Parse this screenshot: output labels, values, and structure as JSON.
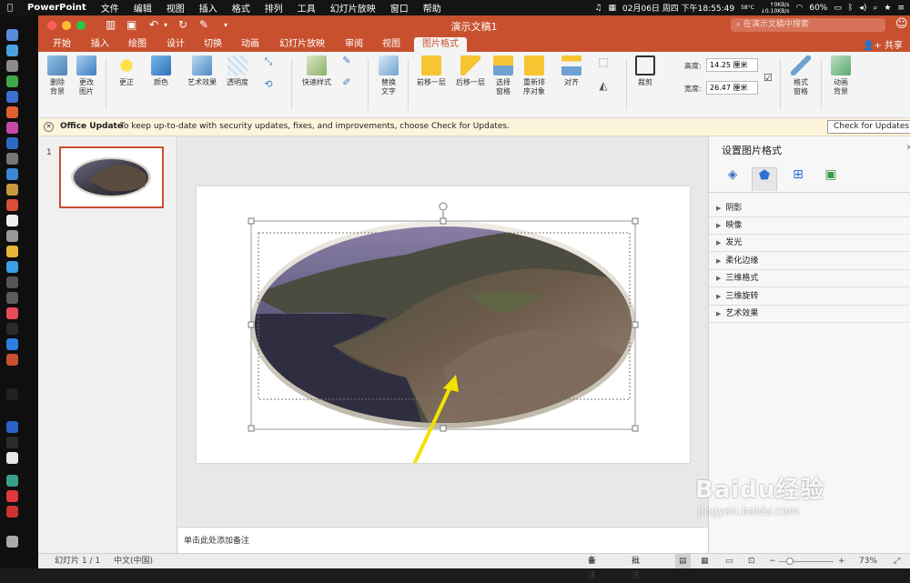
{
  "menubar": {
    "app": "PowerPoint",
    "items": [
      "文件",
      "编辑",
      "视图",
      "插入",
      "格式",
      "排列",
      "工具",
      "幻灯片放映",
      "窗口",
      "帮助"
    ],
    "clock": "02月06日 周四 下午18:55:49",
    "temp": "58°C",
    "net_up": "↑0KB/s",
    "net_down": "↓0.10KB/s",
    "battery": "60%"
  },
  "window": {
    "title": "演示文稿1",
    "search_placeholder": "在演示文稿中搜索",
    "share_label": "共享"
  },
  "tabs": [
    "开始",
    "插入",
    "绘图",
    "设计",
    "切换",
    "动画",
    "幻灯片放映",
    "审阅",
    "视图",
    "图片格式"
  ],
  "active_tab": "图片格式",
  "ribbon": {
    "buttons": [
      {
        "id": "remove-bg",
        "label": "删除\n背景"
      },
      {
        "id": "change-pic",
        "label": "更改\n图片"
      },
      {
        "id": "corrections",
        "label": "更正"
      },
      {
        "id": "color",
        "label": "颜色"
      },
      {
        "id": "artistic",
        "label": "艺术效果"
      },
      {
        "id": "transparency",
        "label": "透明度"
      },
      {
        "id": "quick-styles",
        "label": "快速样式"
      },
      {
        "id": "alt-text",
        "label": "替换\n文字"
      },
      {
        "id": "bring-forward",
        "label": "前移一层"
      },
      {
        "id": "send-backward",
        "label": "后移一层"
      },
      {
        "id": "selection-pane",
        "label": "选择\n窗格"
      },
      {
        "id": "reorder",
        "label": "重新排\n序对象"
      },
      {
        "id": "align",
        "label": "对齐"
      },
      {
        "id": "crop",
        "label": "裁剪"
      },
      {
        "id": "format-pane",
        "label": "格式\n窗格"
      },
      {
        "id": "animate-bg",
        "label": "动画\n背景"
      }
    ],
    "height_label": "高度:",
    "height_value": "14.25 厘米",
    "width_label": "宽度:",
    "width_value": "26.47 厘米"
  },
  "update_bar": {
    "title": "Office Update",
    "message": "To keep up-to-date with security updates, fixes, and improvements, choose Check for Updates.",
    "button": "Check for Updates"
  },
  "thumbnail_number": "1",
  "notes_placeholder": "单击此处添加备注",
  "format_pane": {
    "title": "设置图片格式",
    "sections": [
      "阴影",
      "映像",
      "发光",
      "柔化边缘",
      "三维格式",
      "三维旋转",
      "艺术效果"
    ]
  },
  "status": {
    "slide": "幻灯片 1 / 1",
    "lang": "中文(中国)",
    "notes": "备注",
    "comments": "批注",
    "zoom": "73%"
  },
  "watermark": {
    "logo": "Baidu经验",
    "url": "jingyan.baidu.com"
  },
  "colors": {
    "accent": "#c8502f",
    "annotation_arrow": "#f2e200"
  }
}
